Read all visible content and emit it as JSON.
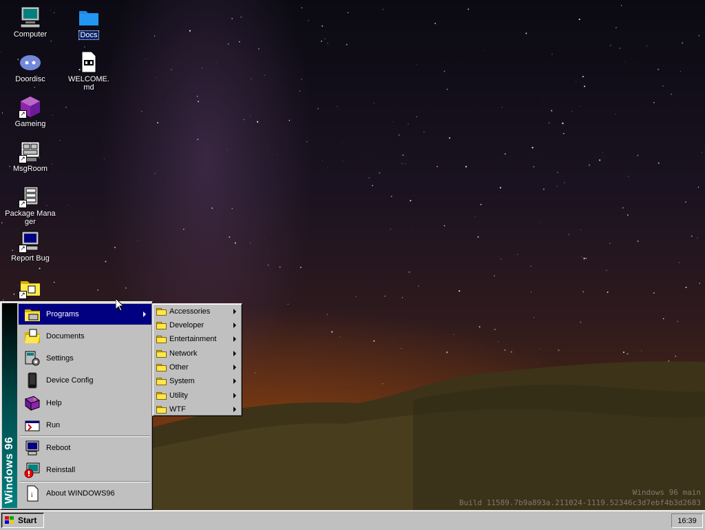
{
  "desktop": {
    "icons": [
      {
        "label": "Computer",
        "icon": "computer-icon"
      },
      {
        "label": "Docs",
        "icon": "folder-icon",
        "selected": true
      },
      {
        "label": "Doordisc",
        "icon": "discord-icon"
      },
      {
        "label": "WELCOME.md",
        "icon": "markdown-file-icon"
      },
      {
        "label": "Gameing",
        "icon": "game-cube-icon"
      },
      {
        "label": "MsgRoom",
        "icon": "chat-app-icon"
      },
      {
        "label": "Package Manager",
        "icon": "package-manager-icon"
      },
      {
        "label": "Report Bug",
        "icon": "report-bug-icon"
      },
      {
        "label": "",
        "icon": "folder-shortcut-icon"
      }
    ]
  },
  "start_menu": {
    "banner": "Windows 96",
    "items": [
      {
        "label": "Programs",
        "icon": "programs-icon",
        "submenu": true,
        "highlighted": true
      },
      {
        "label": "Documents",
        "icon": "documents-icon"
      },
      {
        "label": "Settings",
        "icon": "settings-icon"
      },
      {
        "label": "Device Config",
        "icon": "device-config-icon"
      },
      {
        "label": "Help",
        "icon": "help-book-icon"
      },
      {
        "label": "Run",
        "icon": "run-icon"
      },
      {
        "label": "Reboot",
        "icon": "reboot-icon"
      },
      {
        "label": "Reinstall",
        "icon": "reinstall-icon"
      },
      {
        "label": "About WINDOWS96",
        "icon": "about-icon"
      }
    ]
  },
  "programs_submenu": {
    "items": [
      {
        "label": "Accessories"
      },
      {
        "label": "Developer"
      },
      {
        "label": "Entertainment"
      },
      {
        "label": "Network"
      },
      {
        "label": "Other"
      },
      {
        "label": "System"
      },
      {
        "label": "Utility"
      },
      {
        "label": "WTF"
      }
    ]
  },
  "taskbar": {
    "start_label": "Start",
    "clock": "16:39"
  },
  "watermark": {
    "line1": "Windows 96 main",
    "line2": "Build 11589.7b9a893a.211024-1119.52346c3d7ebf4b3d2683"
  },
  "colors": {
    "highlight": "#000080",
    "chrome": "#c0c0c0",
    "banner_teal": "#008080"
  }
}
